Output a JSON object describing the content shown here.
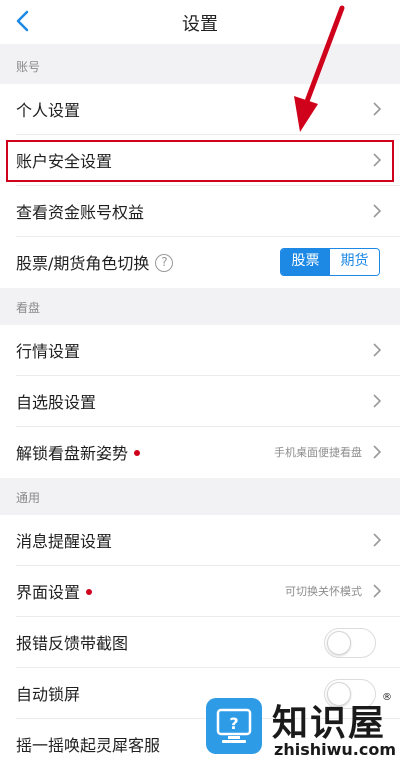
{
  "header": {
    "title": "设置"
  },
  "sections": {
    "account": "账号",
    "market": "看盘",
    "general": "通用"
  },
  "rows": {
    "personal": {
      "label": "个人设置"
    },
    "security": {
      "label": "账户安全设置"
    },
    "fund_rights": {
      "label": "查看资金账号权益"
    },
    "role_switch": {
      "label": "股票/期货角色切换",
      "help_icon": "?",
      "options": [
        "股票",
        "期货"
      ],
      "selected": "股票"
    },
    "quote": {
      "label": "行情设置"
    },
    "watchlist": {
      "label": "自选股设置"
    },
    "unlock": {
      "label": "解锁看盘新姿势",
      "hint": "手机桌面便捷看盘"
    },
    "reminder": {
      "label": "消息提醒设置"
    },
    "interface": {
      "label": "界面设置",
      "hint": "可切换关怀模式"
    },
    "feedback": {
      "label": "报错反馈带截图",
      "toggle": false
    },
    "autolock": {
      "label": "自动锁屏",
      "toggle": false
    },
    "shake": {
      "label": "摇一摇唤起灵犀客服"
    }
  },
  "watermark": {
    "brand": "知识屋",
    "domain": "zhishiwu.com",
    "mark": "®"
  },
  "colors": {
    "accent": "#1e88e5",
    "highlight": "#d0021b",
    "dot": "#d0021b"
  }
}
